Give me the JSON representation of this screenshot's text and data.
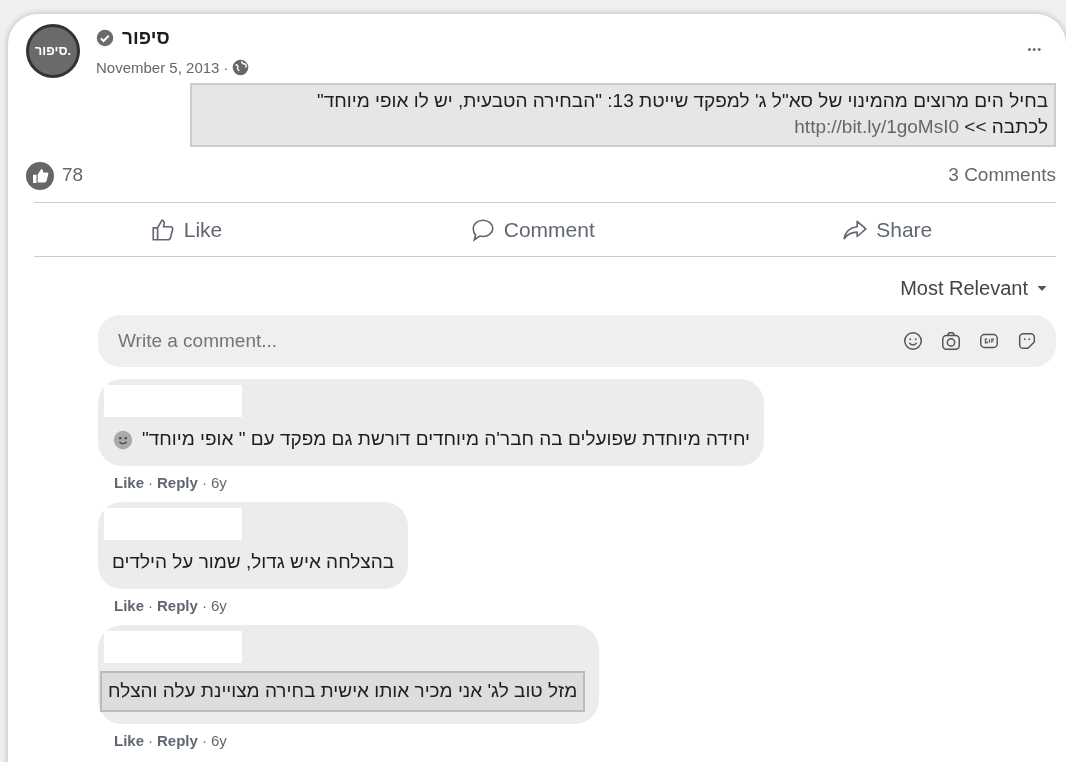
{
  "post": {
    "page_name": "סיפור",
    "avatar_text": "סיפור.",
    "verified": true,
    "date": "November 5, 2013",
    "separator": "·",
    "more": "•••",
    "text_lines": [
      "בחיל הים מרוצים מהמינוי של סא\"ל ג' למפקד שייטת 13: \"הבחירה הטבעית, יש לו אופי מיוחד\""
    ],
    "link_prefix": "לכתבה >>",
    "link": "http://bit.ly/1goMsI0",
    "highlighted": true
  },
  "reactions": {
    "count": "78",
    "comments": "3 Comments"
  },
  "actions": {
    "like": "Like",
    "comment": "Comment",
    "share": "Share"
  },
  "sort": {
    "label": "Most Relevant"
  },
  "comment_box": {
    "placeholder": "Write a comment..."
  },
  "comments": [
    {
      "text": "יחידה מיוחדת שפועלים בה חבר'ה מיוחדים דורשת גם מפקד עם \" אופי מיוחד\"",
      "emoji": true,
      "highlighted": false,
      "like_link": "Like",
      "reply_link": "Reply",
      "time": "6y"
    },
    {
      "text": "בהצלחה איש גדול, שמור על הילדים",
      "emoji": false,
      "highlighted": false,
      "like_link": "Like",
      "reply_link": "Reply",
      "time": "6y"
    },
    {
      "text": "מזל טוב לג' אני מכיר אותו אישית בחירה מצויינת עלה והצלח",
      "emoji": false,
      "highlighted": true,
      "like_link": "Like",
      "reply_link": "Reply",
      "time": "6y"
    }
  ]
}
